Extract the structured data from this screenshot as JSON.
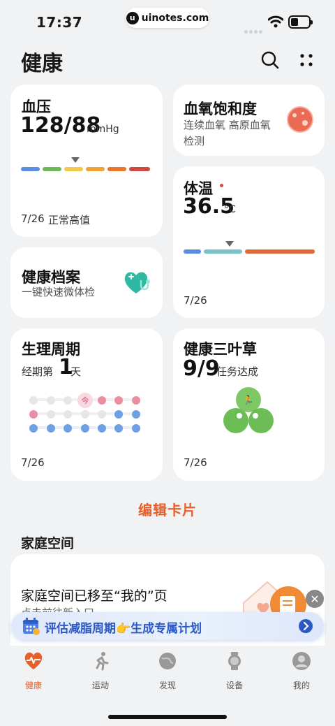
{
  "status_bar": {
    "time": "17:37",
    "url": "uinotes.com",
    "logo_letter": "u"
  },
  "header": {
    "title": "健康"
  },
  "cards": {
    "blood_pressure": {
      "title": "血压",
      "value": "128/88",
      "unit": "mmHg",
      "date": "7/26",
      "status": "正常高值"
    },
    "blood_oxygen": {
      "title": "血氧饱和度",
      "desc_line1": "连续血氧 高原血氧",
      "desc_line2": "检测"
    },
    "temperature": {
      "title": "体温",
      "value": "36.5",
      "unit": "°C",
      "date": "7/26"
    },
    "health_record": {
      "title": "健康档案",
      "desc": "一键快速微体检"
    },
    "period": {
      "title": "生理周期",
      "prefix": "经期第",
      "day": "1",
      "suffix": "天",
      "today_label": "今",
      "date": "7/26"
    },
    "clover": {
      "title": "健康三叶草",
      "value": "9/9",
      "desc": "任务达成",
      "date": "7/26"
    }
  },
  "edit_cards_label": "编辑卡片",
  "family": {
    "section_title": "家庭空间",
    "message": "家庭空间已移至“我的”页",
    "hint": "点击前往新入口"
  },
  "banner": {
    "text": "评估减脂周期👉生成专属计划"
  },
  "tabs": [
    {
      "label": "健康",
      "icon": "heart-pulse-icon"
    },
    {
      "label": "运动",
      "icon": "running-icon"
    },
    {
      "label": "发现",
      "icon": "planet-icon"
    },
    {
      "label": "设备",
      "icon": "watch-icon"
    },
    {
      "label": "我的",
      "icon": "person-icon"
    }
  ],
  "colors": {
    "accent": "#e5602a",
    "banner_text": "#2b58c4",
    "teal": "#2fb9a3"
  }
}
